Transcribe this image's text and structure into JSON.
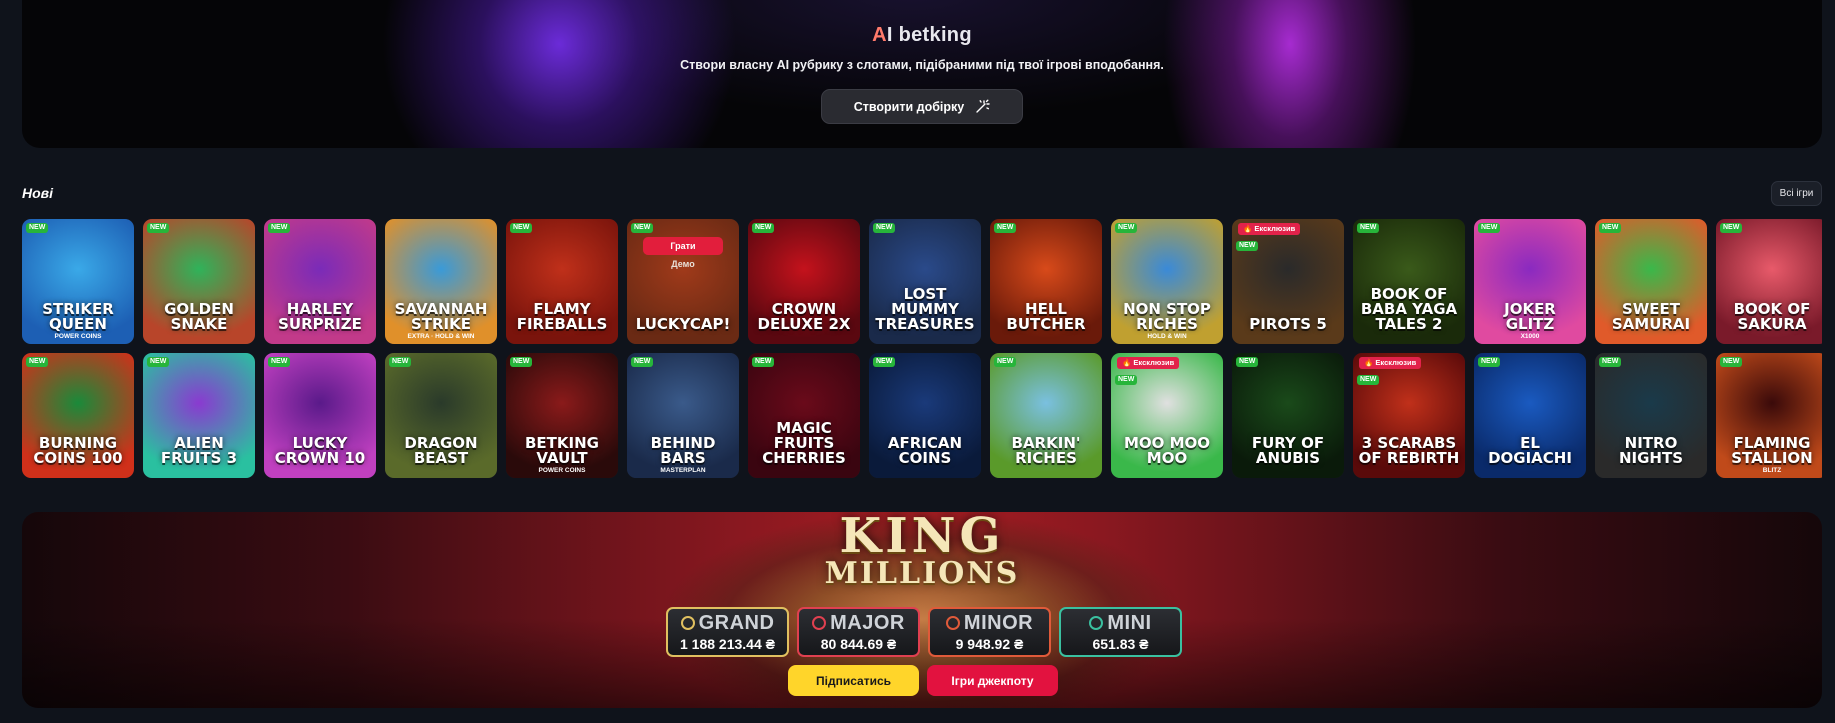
{
  "ai_banner": {
    "title_first": "A",
    "title_rest": "I betking",
    "subtitle": "Створи власну AI рубрику з слотами, підібраними під твої ігрові вподобання.",
    "button_label": "Створити добірку",
    "button_icon": "magic-wand-icon"
  },
  "section": {
    "title": "Нові",
    "all_games_label": "Всі ігри"
  },
  "badges": {
    "new": "NEW",
    "exclusive": "🔥 Ексклюзив"
  },
  "hover_actions": {
    "play": "Грати",
    "demo": "Демо"
  },
  "games_row1": [
    {
      "name": "Striker Queen",
      "sub": "Power Coins",
      "badge": "new",
      "colors": [
        "#3aa9e8",
        "#1d5fb4"
      ]
    },
    {
      "name": "Golden Snake",
      "sub": "",
      "badge": "new",
      "colors": [
        "#2fb35a",
        "#b8452a"
      ]
    },
    {
      "name": "Harley SurPrize",
      "sub": "",
      "badge": "new",
      "colors": [
        "#7a2bb8",
        "#c23a8a"
      ]
    },
    {
      "name": "Savannah Strike",
      "sub": "Extra · Hold & Win",
      "badge": "",
      "colors": [
        "#3a9ad8",
        "#e0902a"
      ]
    },
    {
      "name": "Flamy Fireballs",
      "sub": "",
      "badge": "new",
      "colors": [
        "#c0301a",
        "#7a140c"
      ]
    },
    {
      "name": "Luckycap!",
      "sub": "",
      "badge": "new",
      "colors": [
        "#a03a1a",
        "#6a2a14"
      ],
      "hover": true
    },
    {
      "name": "Crown Deluxe 2x",
      "sub": "",
      "badge": "new",
      "colors": [
        "#c4121c",
        "#5a0810"
      ]
    },
    {
      "name": "Lost Mummy Treasures",
      "sub": "",
      "badge": "new",
      "colors": [
        "#2a4a8a",
        "#1a2a4a"
      ]
    },
    {
      "name": "Hell Butcher",
      "sub": "",
      "badge": "new",
      "colors": [
        "#d84a1a",
        "#6a1a0a"
      ]
    },
    {
      "name": "Non Stop Riches",
      "sub": "Hold & Win",
      "badge": "new",
      "colors": [
        "#3a8ad8",
        "#c0a030"
      ]
    },
    {
      "name": "Pirots 5",
      "sub": "",
      "badge": "excl",
      "colors": [
        "#2a2a2a",
        "#5a3a1a"
      ]
    },
    {
      "name": "Book of Baba Yaga Tales 2",
      "sub": "",
      "badge": "new",
      "colors": [
        "#3a5a1a",
        "#1a2a0a"
      ]
    },
    {
      "name": "Joker Glitz",
      "sub": "x1000",
      "badge": "new",
      "colors": [
        "#8a2ac0",
        "#e04aa0"
      ]
    },
    {
      "name": "Sweet Samurai",
      "sub": "",
      "badge": "new",
      "colors": [
        "#3ab84a",
        "#e05a2a"
      ]
    },
    {
      "name": "Book of Sakura",
      "sub": "",
      "badge": "new",
      "colors": [
        "#e85a6a",
        "#7a1a2a"
      ]
    }
  ],
  "games_row2": [
    {
      "name": "Burning Coins 100",
      "sub": "",
      "badge": "new",
      "colors": [
        "#1a8a3a",
        "#d0301a"
      ]
    },
    {
      "name": "Alien Fruits 3",
      "sub": "",
      "badge": "new",
      "colors": [
        "#8a3ad0",
        "#2ac0a0"
      ]
    },
    {
      "name": "Lucky Crown 10",
      "sub": "",
      "badge": "new",
      "colors": [
        "#5a1a8a",
        "#c040c0"
      ]
    },
    {
      "name": "Dragon Beast",
      "sub": "",
      "badge": "new",
      "colors": [
        "#2a3a2a",
        "#5a6a2a"
      ]
    },
    {
      "name": "Betking Vault",
      "sub": "Power Coins",
      "badge": "new",
      "colors": [
        "#8a1a1a",
        "#2a0a0a"
      ]
    },
    {
      "name": "Behind Bars",
      "sub": "Masterplan",
      "badge": "new",
      "colors": [
        "#3a5a8a",
        "#1a2a4a"
      ]
    },
    {
      "name": "Magic Fruits Cherries",
      "sub": "",
      "badge": "new",
      "colors": [
        "#6a0a1a",
        "#3a0510"
      ]
    },
    {
      "name": "African Coins",
      "sub": "",
      "badge": "new",
      "colors": [
        "#1a3a7a",
        "#0a1a3a"
      ]
    },
    {
      "name": "Barkin' Riches",
      "sub": "",
      "badge": "new",
      "colors": [
        "#7ac0e0",
        "#5a9a2a"
      ]
    },
    {
      "name": "Moo Moo Moo",
      "sub": "",
      "badge": "excl",
      "colors": [
        "#e0e0e0",
        "#3ab84a"
      ]
    },
    {
      "name": "Fury of Anubis",
      "sub": "",
      "badge": "new",
      "colors": [
        "#1a4a1a",
        "#0a1a0a"
      ]
    },
    {
      "name": "3 Scarabs of Rebirth",
      "sub": "",
      "badge": "excl",
      "colors": [
        "#c0301a",
        "#5a0a0a"
      ]
    },
    {
      "name": "El Dogiachi",
      "sub": "",
      "badge": "new",
      "colors": [
        "#1a5ac0",
        "#0a2a6a"
      ]
    },
    {
      "name": "Nitro Nights",
      "sub": "",
      "badge": "new",
      "colors": [
        "#1a3a4a",
        "#2a2a2a"
      ]
    },
    {
      "name": "Flaming Stallion",
      "sub": "Blitz",
      "badge": "new",
      "colors": [
        "#3a0a0a",
        "#c04a1a"
      ]
    }
  ],
  "jackpot": {
    "logo_line1": "KING",
    "logo_line2": "MILLIONS",
    "tiers": [
      {
        "name": "GRAND",
        "value": "1 188 213.44 ₴",
        "color": "#e0c060"
      },
      {
        "name": "MAJOR",
        "value": "80 844.69 ₴",
        "color": "#e04050"
      },
      {
        "name": "MINOR",
        "value": "9 948.92 ₴",
        "color": "#e05a3a"
      },
      {
        "name": "MINI",
        "value": "651.83 ₴",
        "color": "#3ac0a0"
      }
    ],
    "subscribe_label": "Підписатись",
    "games_label": "Ігри джекпоту"
  }
}
